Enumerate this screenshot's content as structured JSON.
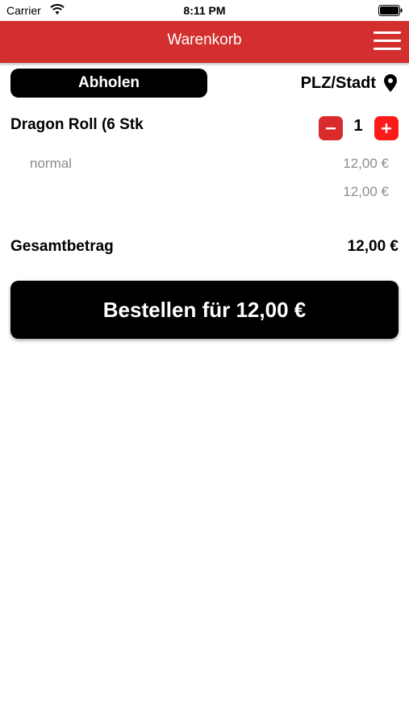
{
  "colors": {
    "accent": "#d32f2f",
    "button_dark": "#000000",
    "secondary_text": "#8c8c8c"
  },
  "status_bar": {
    "carrier": "Carrier",
    "time": "8:11 PM",
    "icons": [
      "wifi-icon",
      "battery-icon"
    ]
  },
  "header": {
    "title": "Warenkorb",
    "menu_icon": "hamburger-menu-icon"
  },
  "delivery": {
    "pickup_label": "Abholen",
    "location_label": "PLZ/Stadt",
    "location_icon": "map-pin-icon"
  },
  "cart": {
    "items": [
      {
        "name": "Dragon Roll (6 Stk",
        "quantity": "1",
        "variant": "normal",
        "variant_price": "12,00 €",
        "subtotal": "12,00 €"
      }
    ]
  },
  "summary": {
    "total_label": "Gesamtbetrag",
    "total_value": "12,00 €"
  },
  "order": {
    "button_label": "Bestellen für 12,00 €"
  }
}
